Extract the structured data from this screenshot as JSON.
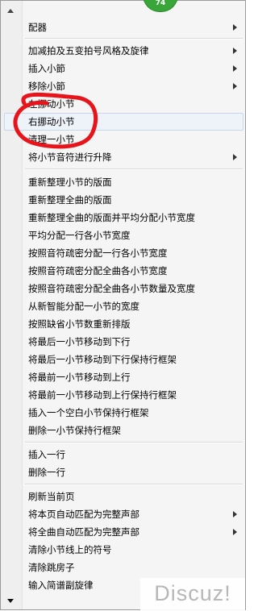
{
  "badge": {
    "value": "74"
  },
  "menu": {
    "items": [
      {
        "label": "配器",
        "submenu": true
      },
      {
        "label": "加减拍及五变拍号风格及旋律",
        "submenu": true
      },
      {
        "label": "插入小節",
        "submenu": true
      },
      {
        "label": "移除小節",
        "submenu": true
      },
      {
        "label": "左挪动小节",
        "submenu": false
      },
      {
        "label": "右挪动小节",
        "submenu": false,
        "highlighted": true
      },
      {
        "label": "清理一小节",
        "submenu": false
      },
      {
        "label": "将小节音符进行升降",
        "submenu": true
      },
      {
        "label": "重新整理小节的版面"
      },
      {
        "label": "重新整理全曲的版面"
      },
      {
        "label": "重新整理全曲的版面并平均分配小节宽度"
      },
      {
        "label": "平均分配一行各小节宽度"
      },
      {
        "label": "按照音符疏密分配一行各小节宽度"
      },
      {
        "label": "按照音符疏密分配全曲各小节宽度"
      },
      {
        "label": "按照音符疏密分配全曲各小节数量及宽度"
      },
      {
        "label": "从新智能分配一小节的宽度"
      },
      {
        "label": "按照缺省小节数重新排版"
      },
      {
        "label": "将最后一小节移动到下行"
      },
      {
        "label": "将最后一小节移动到下行保持行框架"
      },
      {
        "label": "将最前一小节移动到上行"
      },
      {
        "label": "将最前一小节移动到上行保持行框架"
      },
      {
        "label": "插入一个空白小节保持行框架"
      },
      {
        "label": "删除一小节保持行框架"
      },
      {
        "label": "插入一行"
      },
      {
        "label": "删除一行"
      },
      {
        "label": "刷新当前页"
      },
      {
        "label": "将本页自动匹配为完整声部",
        "submenu": true
      },
      {
        "label": "将全曲自动匹配为完整声部",
        "submenu": true
      },
      {
        "label": "清除小节线上的符号"
      },
      {
        "label": "清除跳房子"
      },
      {
        "label": "输入简谱副旋律"
      }
    ]
  },
  "annotation": {
    "color": "#e8141b"
  },
  "watermark": {
    "text": "Discuz!"
  }
}
